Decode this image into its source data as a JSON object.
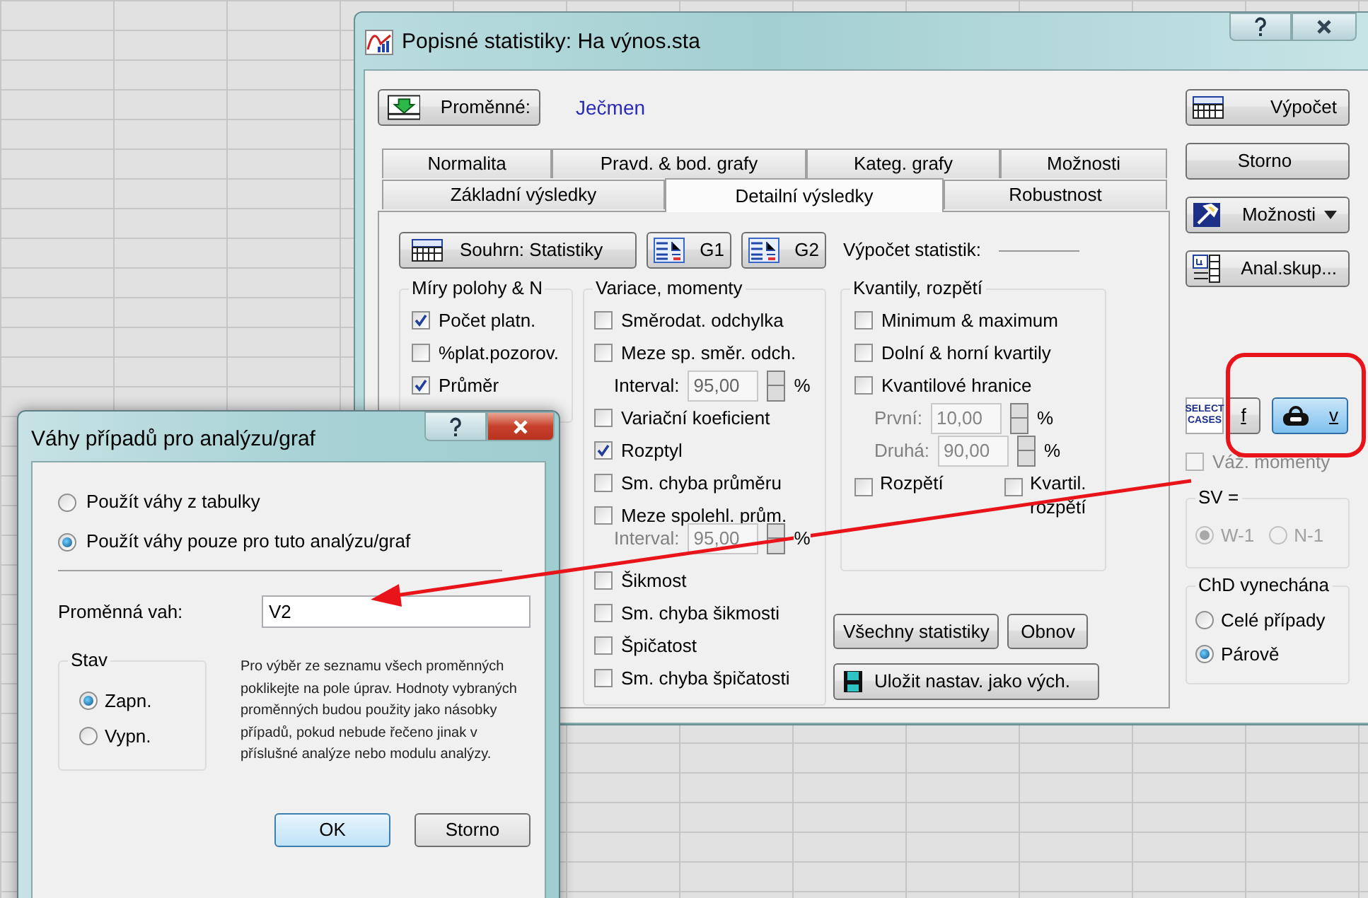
{
  "main_window": {
    "title": "Popisné statistiky: Ha výnos.sta",
    "variables_button": "Proměnné:",
    "variable_value": "Ječmen",
    "tab_rows": [
      [
        {
          "label": "Normalita",
          "selected": false
        },
        {
          "label": "Pravd. & bod. grafy",
          "selected": false
        },
        {
          "label": "Kateg. grafy",
          "selected": false
        },
        {
          "label": "Možnosti",
          "selected": false
        }
      ],
      [
        {
          "label": "Základní výsledky",
          "selected": false
        },
        {
          "label": "Detailní výsledky",
          "selected": true
        },
        {
          "label": "Robustnost",
          "selected": false
        }
      ]
    ],
    "summary_button": "Souhrn: Statistiky",
    "graph_buttons": [
      "G1",
      "G2"
    ],
    "compute_label": "Výpočet statistik:",
    "groups": [
      {
        "title": "Míry polohy & N",
        "items": [
          {
            "kind": "checkbox",
            "label": "Počet platn.",
            "checked": true
          },
          {
            "kind": "checkbox",
            "label": "%plat.pozorov.",
            "checked": false
          },
          {
            "kind": "checkbox",
            "label": "Průměr",
            "checked": true
          }
        ]
      },
      {
        "title": "Variace, momenty",
        "items": [
          {
            "kind": "checkbox",
            "label": "Směrodat. odchylka",
            "checked": false
          },
          {
            "kind": "checkbox",
            "label": "Meze sp. směr. odch.",
            "checked": false
          },
          {
            "kind": "spinner",
            "label": "Interval:",
            "value": "95,00",
            "unit": "%",
            "disabled": false
          },
          {
            "kind": "checkbox",
            "label": "Variační koeficient",
            "checked": false
          },
          {
            "kind": "checkbox",
            "label": "Rozptyl",
            "checked": true
          },
          {
            "kind": "checkbox",
            "label": "Sm. chyba průměru",
            "checked": false
          },
          {
            "kind": "checkbox",
            "label": "Meze spolehl. prům.",
            "checked": false
          },
          {
            "kind": "spinner",
            "label": "Interval:",
            "value": "95,00",
            "unit": "%",
            "disabled": true
          },
          {
            "kind": "checkbox",
            "label": "Šikmost",
            "checked": false
          },
          {
            "kind": "checkbox",
            "label": "Sm. chyba šikmosti",
            "checked": false
          },
          {
            "kind": "checkbox",
            "label": "Špičatost",
            "checked": false
          },
          {
            "kind": "checkbox",
            "label": "Sm. chyba špičatosti",
            "checked": false
          }
        ]
      },
      {
        "title": "Kvantily, rozpětí",
        "items": [
          {
            "kind": "checkbox",
            "label": "Minimum & maximum",
            "checked": false
          },
          {
            "kind": "checkbox",
            "label": "Dolní & horní kvartily",
            "checked": false
          },
          {
            "kind": "checkbox",
            "label": "Kvantilové hranice",
            "checked": false
          },
          {
            "kind": "spinner",
            "label": "První:",
            "value": "10,00",
            "unit": "%",
            "disabled": true
          },
          {
            "kind": "spinner",
            "label": "Druhá:",
            "value": "90,00",
            "unit": "%",
            "disabled": true
          },
          {
            "kind": "pair",
            "items": [
              {
                "label": "Rozpětí",
                "checked": false
              },
              {
                "label": "Kvartil. rozpětí",
                "checked": false
              }
            ]
          }
        ]
      }
    ],
    "all_stats_button": "Všechny statistiky",
    "reset_button": "Obnov",
    "save_defaults_button": "Uložit nastav. jako vých.",
    "side_buttons": [
      {
        "label": "Výpočet",
        "kind": "sum"
      },
      {
        "label": "Storno",
        "kind": "plain"
      },
      {
        "label": "Možnosti",
        "kind": "menu"
      },
      {
        "label": "Anal.skup...",
        "kind": "by"
      }
    ],
    "select_cases": "SELECT CASES",
    "filter_button": "f",
    "weight_button": {
      "label": "v",
      "selected": true
    },
    "weighted_moments": {
      "label": "Váž. momenty",
      "checked": false
    },
    "sv_group": {
      "title": "SV =",
      "disabled": true,
      "options": [
        {
          "label": "W-1",
          "selected": true
        },
        {
          "label": "N-1",
          "selected": false
        }
      ]
    },
    "missing_group": {
      "title": "ChD vynechána",
      "disabled": false,
      "options": [
        {
          "label": "Celé případy",
          "selected": false
        },
        {
          "label": "Párově",
          "selected": true
        }
      ]
    }
  },
  "weights_dialog": {
    "title": "Váhy případů pro analýzu/graf",
    "options": [
      {
        "label": "Použít váhy z tabulky",
        "selected": false
      },
      {
        "label": "Použít váhy pouze pro tuto analýzu/graf",
        "selected": true
      }
    ],
    "field_label": "Proměnná vah:",
    "field_value": "V2",
    "status_group": {
      "title": "Stav",
      "disabled": false,
      "options": [
        {
          "label": "Zapn.",
          "selected": true
        },
        {
          "label": "Vypn.",
          "selected": false
        }
      ]
    },
    "help_text": "Pro výběr ze seznamu všech proměnných poklikejte na pole úprav. Hodnoty vybraných proměnných budou použity jako násobky případů, pokud nebude řečeno jinak v příslušné analýze nebo modulu analýzy.",
    "buttons": [
      {
        "label": "OK",
        "default": true
      },
      {
        "label": "Storno",
        "default": false
      }
    ]
  }
}
